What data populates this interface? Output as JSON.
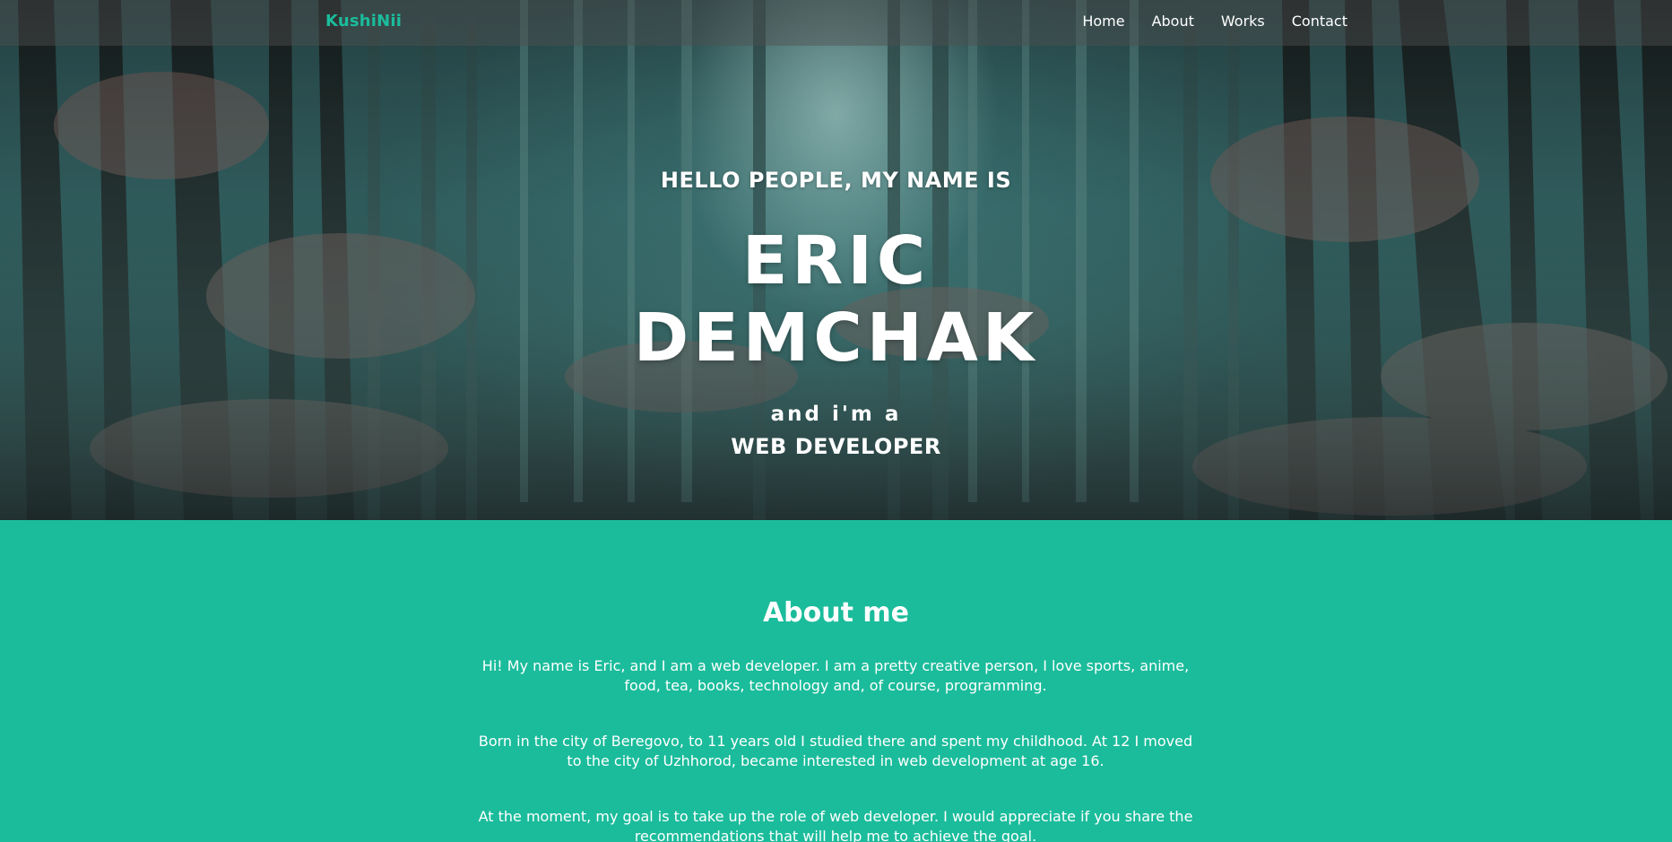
{
  "nav": {
    "logo": "KushiNii",
    "links": [
      "Home",
      "About",
      "Works",
      "Contact"
    ]
  },
  "hero": {
    "greeting": "HELLO PEOPLE, MY NAME IS",
    "first_name": "ERIC",
    "last_name": "DEMCHAK",
    "subtitle": "and i'm a",
    "role": "WEB DEVELOPER"
  },
  "about": {
    "title": "About me",
    "paragraphs": [
      "Hi! My name is Eric, and I am a web developer. I am a pretty creative person, I love sports, anime, food, tea, books, technology and, of course, programming.",
      "Born in the city of Beregovo, to 11 years old I studied there and spent my childhood. At 12 I moved to the city of Uzhhorod, became interested in web development at age 16.",
      "At the moment, my goal is to take up the role of web developer. I would appreciate if you share the recommendations that will help me to achieve the goal."
    ]
  },
  "colors": {
    "accent": "#1bbc9b",
    "text_light": "#ffffff"
  }
}
